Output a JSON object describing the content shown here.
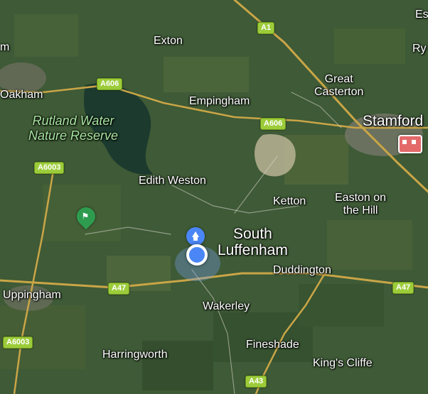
{
  "map": {
    "view": "satellite",
    "places": {
      "oakham": "Oakham",
      "exton": "Exton",
      "empingham": "Empingham",
      "great_casterton": "Great\nCasterton",
      "stamford": "Stamford",
      "rutland_water": "Rutland Water\nNature Reserve",
      "edith_weston": "Edith Weston",
      "ketton": "Ketton",
      "easton_on_the_hill": "Easton on\nthe Hill",
      "south_luffenham": "South\nLuffenham",
      "duddington": "Duddington",
      "uppingham": "Uppingham",
      "wakerley": "Wakerley",
      "fineshade": "Fineshade",
      "harringworth": "Harringworth",
      "kings_cliffe": "King's Cliffe",
      "edge_m": "m",
      "edge_es": "Es",
      "edge_ry": "Ry"
    },
    "roads": {
      "a1": "A1",
      "a606_west": "A606",
      "a606_east": "A606",
      "a6003_north": "A6003",
      "a6003_south": "A6003",
      "a47_west": "A47",
      "a47_east": "A47",
      "a43": "A43"
    },
    "colors": {
      "land": "#3e5a36",
      "water": "#1c3a2e",
      "road": "#c9a547",
      "shield": "#9ccc3a",
      "location_blue": "#4a86f5"
    },
    "markers": {
      "current_location": "blue-dot",
      "saved_place": "green-flag-pin",
      "stamford_poi": "building-icon"
    }
  }
}
